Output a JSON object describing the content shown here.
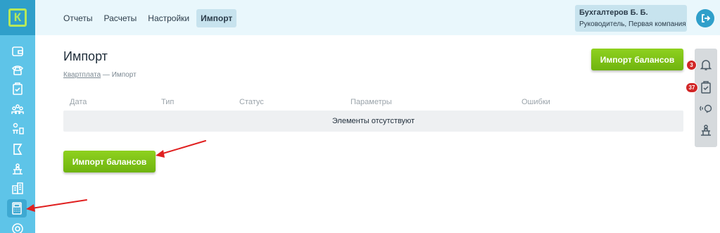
{
  "brand": {
    "logo_letter": "К"
  },
  "nav": {
    "items": [
      {
        "label": "Отчеты"
      },
      {
        "label": "Расчеты"
      },
      {
        "label": "Настройки"
      },
      {
        "label": "Импорт"
      }
    ]
  },
  "user": {
    "name": "Бухгалтеров Б. Б.",
    "role": "Руководитель, Первая компания"
  },
  "page": {
    "title": "Импорт",
    "breadcrumb": {
      "link": "Квартплата",
      "separator": " — ",
      "current": "Импорт"
    },
    "import_button_label": "Импорт балансов"
  },
  "table": {
    "columns": [
      "Дата",
      "Тип",
      "Статус",
      "Параметры",
      "Ошибки"
    ],
    "empty_text": "Элементы отсутствуют"
  },
  "right_panel": {
    "notifications_count": "3",
    "tasks_count": "37"
  },
  "sidebar": {
    "icons": [
      "wallet-icon",
      "phone-icon",
      "clipboard-icon",
      "people-chart-icon",
      "org-structure-icon",
      "flag-icon",
      "building-desk-icon",
      "buildings-icon",
      "calculator-icon",
      "support-icon"
    ]
  },
  "colors": {
    "sidebar": "#5ec4e8",
    "sidebar_dark": "#2f9fca",
    "accent_green": "#7cc318",
    "badge_red": "#d12626",
    "annotation_arrow": "#e02020"
  }
}
